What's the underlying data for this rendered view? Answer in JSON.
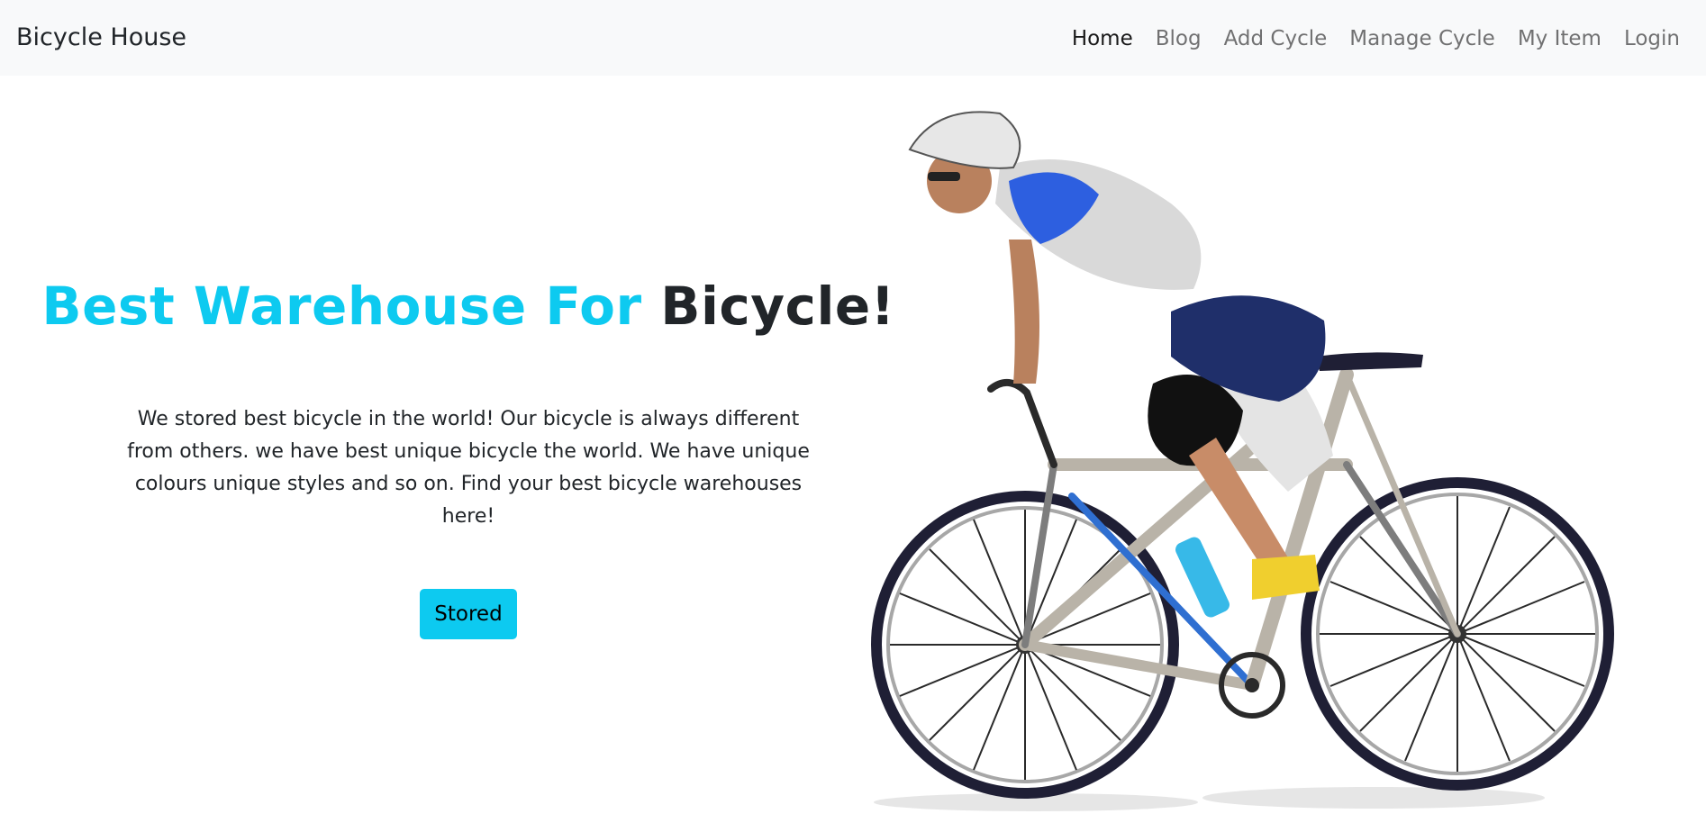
{
  "navbar": {
    "brand": "Bicycle House",
    "links": [
      {
        "label": "Home",
        "active": true
      },
      {
        "label": "Blog",
        "active": false
      },
      {
        "label": "Add Cycle",
        "active": false
      },
      {
        "label": "Manage Cycle",
        "active": false
      },
      {
        "label": "My Item",
        "active": false
      },
      {
        "label": "Login",
        "active": false
      }
    ]
  },
  "hero": {
    "title_accent": "Best Warehouse For",
    "title_dark": "Bicycle!",
    "description": "We stored best bicycle in the world! Our bicycle is always different from others. we have best unique bicycle the world. We have unique colours unique styles and so on. Find your best bicycle warehouses here!",
    "button_label": "Stored",
    "image_icon": "cyclist-on-road-bike-photo"
  },
  "colors": {
    "accent": "#0dcaf0",
    "navbar_bg": "#f8f9fa",
    "text_dark": "#212529"
  }
}
